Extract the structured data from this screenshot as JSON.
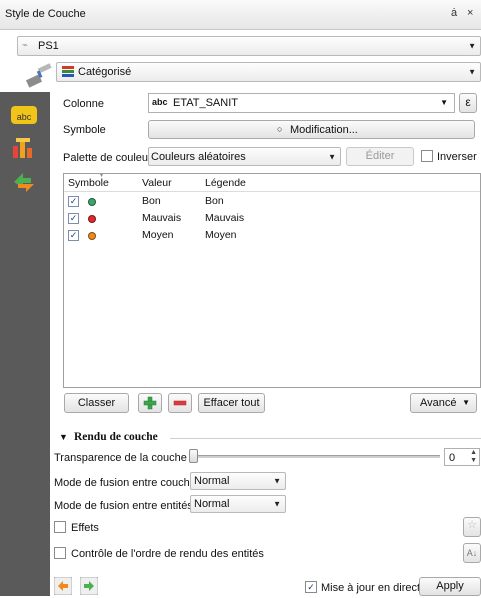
{
  "window": {
    "title": "Style de Couche",
    "float_icon": "float-icon",
    "close_icon": "close-icon",
    "float_glyph": "ȧ",
    "close_glyph": "×"
  },
  "layer_select": {
    "value": "PS1"
  },
  "renderer": {
    "value": "Catégorisé"
  },
  "form": {
    "column_label": "Colonne",
    "column_value": "ETAT_SANIT",
    "column_type_tag": "abc",
    "expression_button": "ε",
    "symbol_label": "Symbole",
    "symbol_button": "Modification...",
    "palette_label": "Palette de couleur",
    "palette_value": "Couleurs aléatoires",
    "edit_button": "Éditer",
    "invert_label": "Inverser"
  },
  "table": {
    "headers": [
      "Symbole",
      "Valeur",
      "Légende"
    ],
    "rows": [
      {
        "checked": true,
        "color": "#3aa66a",
        "value": "Bon",
        "legend": "Bon"
      },
      {
        "checked": true,
        "color": "#e02a2a",
        "value": "Mauvais",
        "legend": "Mauvais"
      },
      {
        "checked": true,
        "color": "#f08a1e",
        "value": "Moyen",
        "legend": "Moyen"
      }
    ]
  },
  "actions": {
    "classify": "Classer",
    "clear_all": "Effacer tout",
    "advanced": "Avancé"
  },
  "rendering": {
    "section_title": "Rendu de couche",
    "transparency_label": "Transparence de la couche",
    "transparency_value": "0",
    "layer_blend_label": "Mode de fusion entre couches",
    "layer_blend_value": "Normal",
    "feature_blend_label": "Mode de fusion entre entités",
    "feature_blend_value": "Normal",
    "effects_label": "Effets",
    "order_label": "Contrôle de l'ordre de rendu des entités"
  },
  "footer": {
    "live_update_label": "Mise à jour en direct",
    "live_update_checked": true,
    "apply": "Apply"
  },
  "colors": {
    "sidebar": "#5a5a5a",
    "accent": "#2a3f7a"
  }
}
